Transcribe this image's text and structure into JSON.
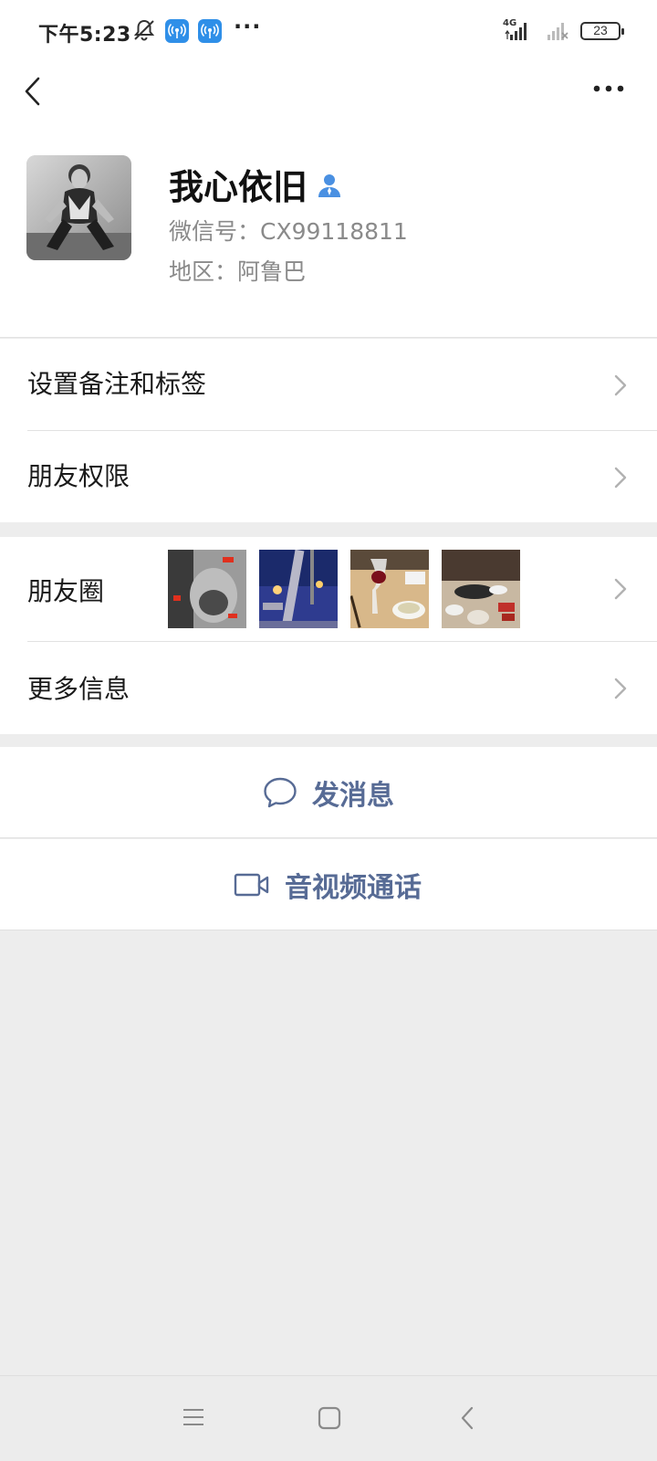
{
  "status_bar": {
    "time": "下午5:23",
    "more": "···",
    "network": "4G",
    "battery": "23"
  },
  "nav": {
    "back_icon": "chevron-left-icon",
    "more_icon": "more-dots-icon"
  },
  "profile": {
    "name": "我心依旧",
    "wechat_id": "微信号：CX99118811",
    "region": "地区：阿鲁巴"
  },
  "list": {
    "remark_tags": "设置备注和标签",
    "friend_permissions": "朋友权限",
    "moments": "朋友圈",
    "more_info": "更多信息"
  },
  "actions": {
    "message": "发消息",
    "call": "音视频通话"
  },
  "colors": {
    "link": "#576b95",
    "page_bg": "#ededed",
    "hotspot": "#2f8fe8",
    "contact_icon": "#4a90e2"
  }
}
